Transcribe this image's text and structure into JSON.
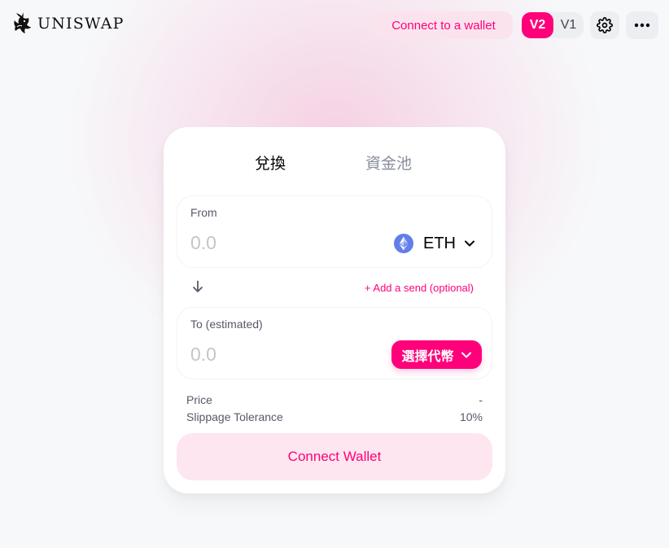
{
  "header": {
    "logo_text": "UNISWAP",
    "connect_label": "Connect to a wallet",
    "version_v2": "V2",
    "version_v1": "V1",
    "icons": {
      "logo": "unicorn-logo-icon",
      "settings": "gear-icon",
      "more": "ellipsis-icon"
    }
  },
  "card": {
    "tabs": [
      {
        "label": "兌換",
        "active": true
      },
      {
        "label": "資金池",
        "active": false
      }
    ],
    "from": {
      "label": "From",
      "amount_placeholder": "0.0",
      "token": "ETH",
      "token_icon": "ethereum-icon"
    },
    "add_send": "+ Add a send (optional)",
    "to": {
      "label": "To (estimated)",
      "amount_placeholder": "0.0",
      "select_token_label": "選擇代幣"
    },
    "price": {
      "label": "Price",
      "value": "-"
    },
    "slippage": {
      "label": "Slippage Tolerance",
      "value": "10%"
    },
    "connect_wallet_label": "Connect Wallet"
  },
  "colors": {
    "accent": "#ff007a",
    "accent_light": "#fde6ef",
    "text_muted": "#565a69",
    "placeholder": "#c3c5cb"
  }
}
